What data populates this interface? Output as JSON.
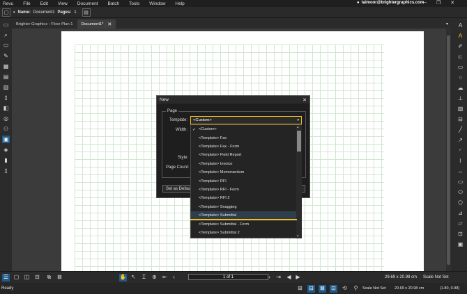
{
  "menubar": {
    "items": [
      "Revu",
      "File",
      "Edit",
      "View",
      "Document",
      "Batch",
      "Tools",
      "Window",
      "Help"
    ],
    "user": "taimoor@brightergraphics.com"
  },
  "docbar": {
    "name_label": "Name:",
    "name_value": "Document1",
    "pages_label": "Pages:",
    "pages_value": "1"
  },
  "tabs": [
    {
      "label": "Brighter Graphics - Floor Plan 1"
    },
    {
      "label": "Document1*"
    }
  ],
  "dialog": {
    "title": "New",
    "group": "Page",
    "template_label": "Template:",
    "template_value": "<Custom>",
    "width_label": "Width:",
    "style_label": "Style:",
    "pagecount_label": "Page Count:",
    "set_default_label": "Set as Default"
  },
  "dropdown": {
    "options": [
      "<Custom>",
      "<Template> Fax",
      "<Template> Fax - Form",
      "<Template> Field Report",
      "<Template> Invoice",
      "<Template> Memorandum",
      "<Template> RFI",
      "<Template> RFI - Form",
      "<Template> RFI 2",
      "<Template> Snagging",
      "<Template> Submittal",
      "<Template> Submittal - Form",
      "<Template> Submittal 2"
    ],
    "checked_index": 0,
    "selected_index": 10
  },
  "navbar": {
    "page_display": "1 of 1",
    "size": "29.69 x 20.98 cm",
    "scale": "Scale Not Set"
  },
  "statusbar": {
    "ready": "Ready",
    "scale": "Scale Not Set",
    "size": "29.69 x 20.98 cm",
    "coords": "(1.80, 0.98)"
  },
  "colors": {
    "highlight": "#f0c020",
    "accent": "#1e5b8a",
    "grid": "#cfe8cf"
  }
}
